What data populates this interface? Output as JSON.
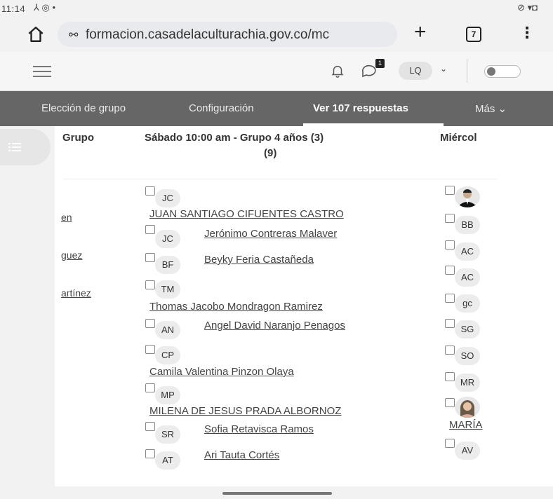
{
  "status": {
    "time": "11:14",
    "left_icons": "⅄ ◎ •",
    "right_icons": "⊘ ▾◘"
  },
  "browser": {
    "url": "formacion.casadelaculturachia.gov.co/mc",
    "tab_count": "7"
  },
  "header": {
    "user_initials": "LQ",
    "chat_badge": "1"
  },
  "nav": {
    "items": [
      "Elección de grupo",
      "Configuración",
      "Ver 107 respuestas",
      "Más ⌄"
    ]
  },
  "table": {
    "col_grupo": "Grupo",
    "col_main_line1": "Sábado 10:00 am - Grupo 4 años (3)",
    "col_main_line2": "(9)",
    "col_right": "Miércol\u0000",
    "left_names": [
      "en",
      "guez",
      "artínez"
    ],
    "students": [
      {
        "initials": "JC",
        "name": "JUAN SANTIAGO CIFUENTES CASTRO"
      },
      {
        "initials": "JC",
        "name": "Jerónimo Contreras Malaver"
      },
      {
        "initials": "BF",
        "name": "Beyky Feria Castañeda"
      },
      {
        "initials": "TM",
        "name": "Thomas Jacobo Mondragon Ramirez"
      },
      {
        "initials": "AN",
        "name": "Angel David Naranjo Penagos"
      },
      {
        "initials": "CP",
        "name": "Camila Valentina Pinzon Olaya"
      },
      {
        "initials": "MP",
        "name": "MILENA DE JESUS PRADA ALBORNOZ"
      },
      {
        "initials": "SR",
        "name": "Sofia Retavisca Ramos"
      },
      {
        "initials": "AT",
        "name": "Ari Tauta Cortés"
      }
    ],
    "right_col": [
      "BB",
      "AC",
      "AC",
      "gc",
      "SG",
      "SO",
      "MR"
    ],
    "right_col_last": "AV",
    "right_name": "MARÍA"
  }
}
